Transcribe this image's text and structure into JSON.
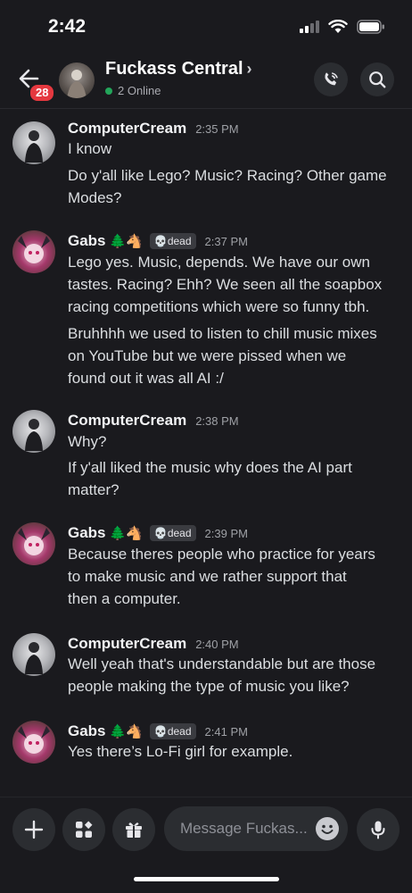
{
  "status_bar": {
    "time": "2:42"
  },
  "header": {
    "badge": "28",
    "title": "Fuckass Central",
    "online": "2 Online"
  },
  "messages": [
    {
      "author": "ComputerCream",
      "emoji": "",
      "tag": "",
      "time": "2:35 PM",
      "lines": [
        "I know",
        "Do y'all like Lego? Music? Racing? Other game",
        "Modes?"
      ]
    },
    {
      "author": "Gabs",
      "emoji": "🌲🐴",
      "tag": "💀dead",
      "time": "2:37 PM",
      "lines": [
        "Lego yes. Music, depends. We have our own",
        "tastes. Racing? Ehh? We seen all the soapbox",
        "racing competitions which were so funny tbh.",
        "Bruhhhh we used to listen to chill music mixes",
        "on YouTube but we were pissed when we",
        "found out it was all AI :/"
      ]
    },
    {
      "author": "ComputerCream",
      "emoji": "",
      "tag": "",
      "time": "2:38 PM",
      "lines": [
        "Why?",
        "If y'all liked the music why does the AI part",
        "matter?"
      ]
    },
    {
      "author": "Gabs",
      "emoji": "🌲🐴",
      "tag": "💀dead",
      "time": "2:39 PM",
      "lines": [
        "Because theres people who practice for years",
        "to make music and we rather support that",
        "then a computer."
      ]
    },
    {
      "author": "ComputerCream",
      "emoji": "",
      "tag": "",
      "time": "2:40 PM",
      "lines": [
        "Well yeah that's understandable but are those",
        "people making the type of music you like?"
      ]
    },
    {
      "author": "Gabs",
      "emoji": "🌲🐴",
      "tag": "💀dead",
      "time": "2:41 PM",
      "lines": [
        "Yes there’s Lo-Fi girl for example."
      ]
    }
  ],
  "composer": {
    "placeholder": "Message Fuckas..."
  },
  "icons": {
    "back": "arrow-left-icon",
    "call": "phone-icon",
    "search": "search-icon",
    "plus": "plus-icon",
    "apps": "apps-icon",
    "gift": "gift-icon",
    "emoji": "emoji-icon",
    "mic": "microphone-icon"
  },
  "colors": {
    "background": "#1a1a1e",
    "badge": "#e5383f",
    "online": "#23a55a"
  }
}
